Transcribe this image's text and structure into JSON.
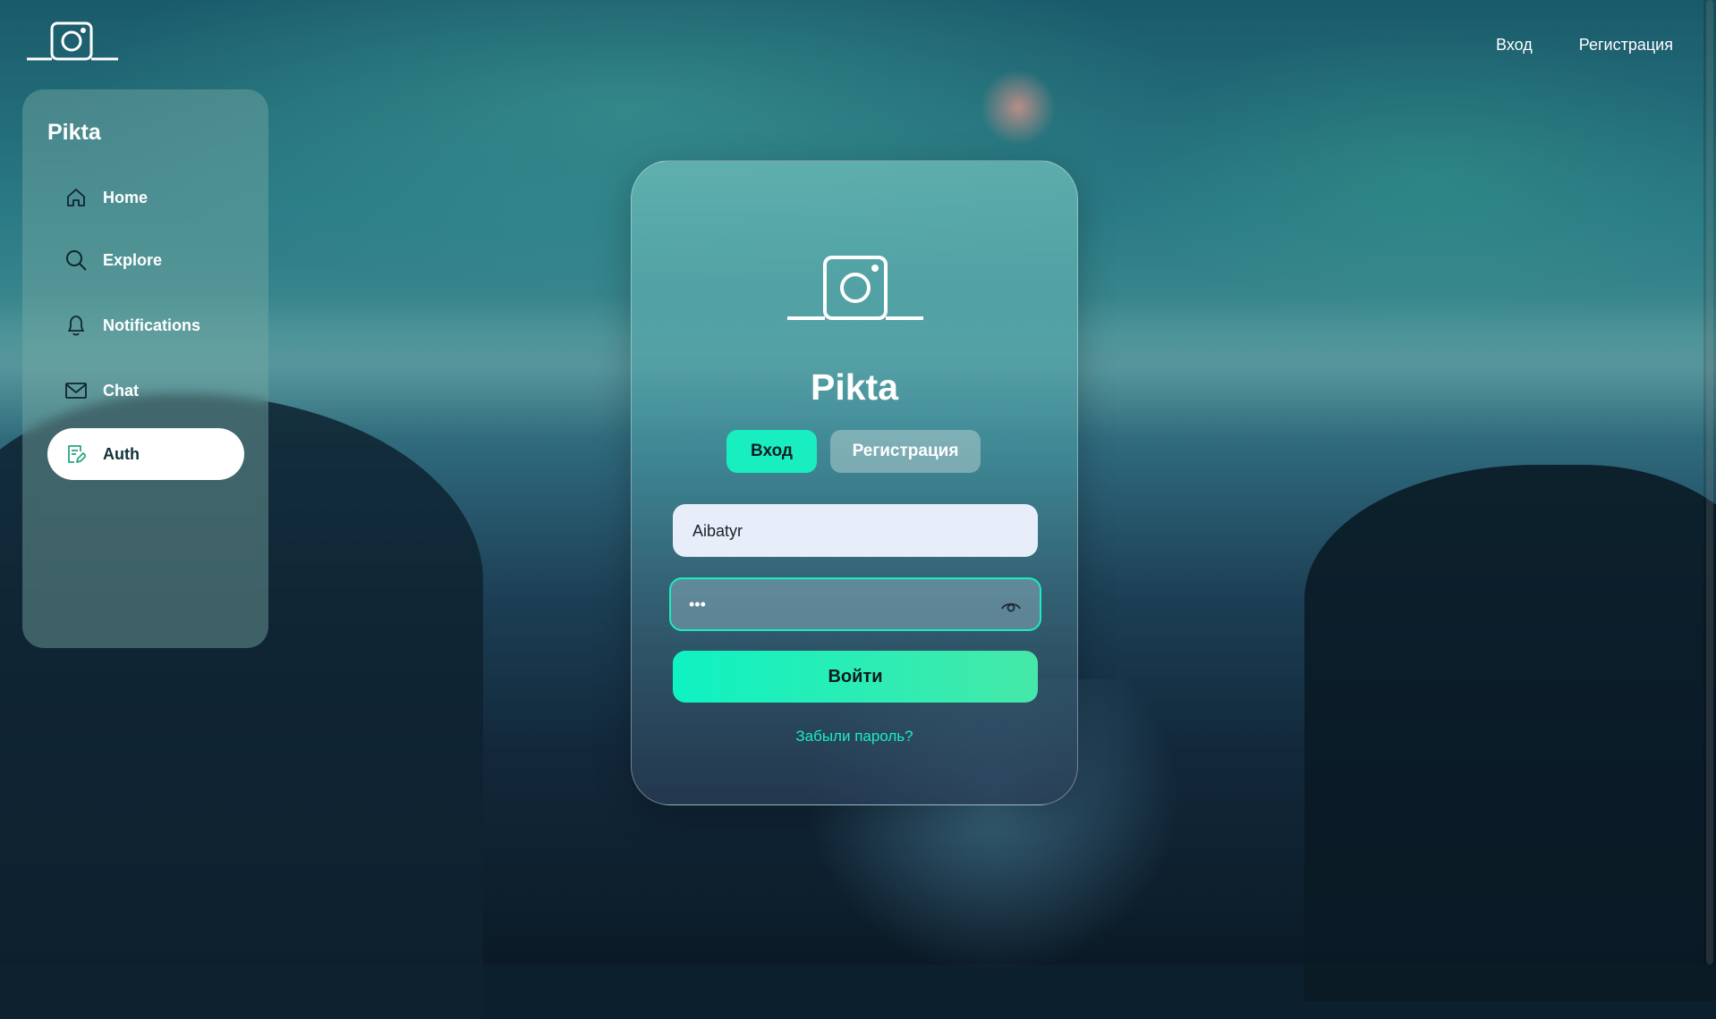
{
  "header": {
    "logo_icon": "camera-icon",
    "nav": [
      {
        "label": "Вход"
      },
      {
        "label": "Регистрация"
      }
    ]
  },
  "sidebar": {
    "brand": "Pikta",
    "items": [
      {
        "label": "Home",
        "icon": "home-icon"
      },
      {
        "label": "Explore",
        "icon": "search-icon"
      },
      {
        "label": "Notifications",
        "icon": "bell-icon"
      },
      {
        "label": "Chat",
        "icon": "mail-icon"
      },
      {
        "label": "Auth",
        "icon": "edit-document-icon",
        "active": true
      }
    ]
  },
  "auth_card": {
    "logo_icon": "camera-icon",
    "title": "Pikta",
    "tabs": {
      "login": "Вход",
      "register": "Регистрация",
      "active": "login"
    },
    "username_value": "Aibatyr",
    "password_masked": "•••",
    "submit_label": "Войти",
    "forgot_label": "Забыли пароль?"
  },
  "colors": {
    "accent": "#19eec0",
    "submit_gradient_start": "#0ff2c2",
    "submit_gradient_end": "#45e8a8",
    "input_bg": "#e7eefa",
    "active_nav_bg": "#ffffff"
  }
}
